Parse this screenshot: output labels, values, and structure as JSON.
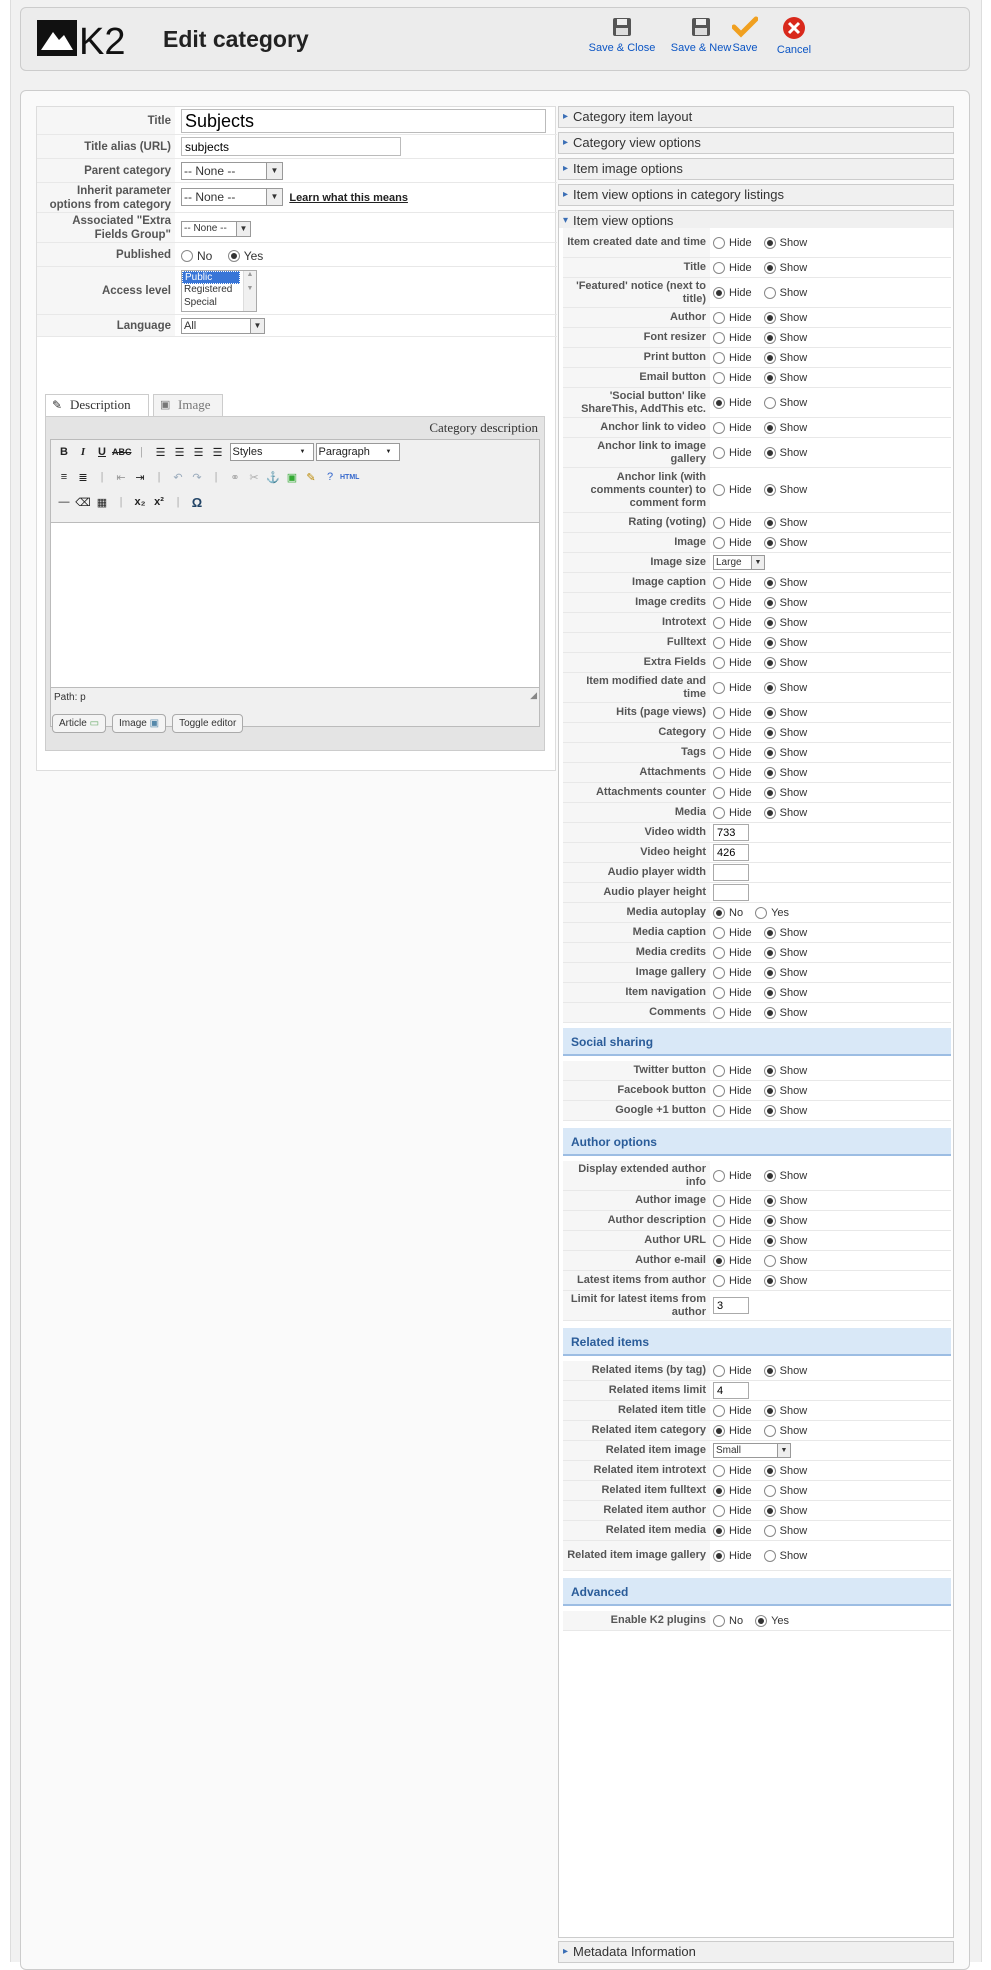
{
  "header": {
    "logo_text": "K2",
    "title": "Edit category",
    "buttons": {
      "save_close": "Save & Close",
      "save_new": "Save & New",
      "save": "Save",
      "cancel": "Cancel"
    }
  },
  "form": {
    "title_label": "Title",
    "title_value": "Subjects",
    "alias_label": "Title alias (URL)",
    "alias_value": "subjects",
    "parent_label": "Parent category",
    "parent_value": "-- None --",
    "inherit_label": "Inherit parameter options from category",
    "inherit_value": "-- None --",
    "inherit_link": "Learn what this means",
    "extra_label": "Associated \"Extra Fields Group\"",
    "extra_value": "-- None --",
    "published_label": "Published",
    "published_no": "No",
    "published_yes": "Yes",
    "access_label": "Access level",
    "access_options": [
      "Public",
      "Registered",
      "Special"
    ],
    "language_label": "Language",
    "language_value": "All"
  },
  "tabs": {
    "description": "Description",
    "image": "Image"
  },
  "editor": {
    "category_description": "Category description",
    "styles": "Styles",
    "paragraph": "Paragraph",
    "path": "Path: p",
    "btn_article": "Article",
    "btn_image": "Image",
    "btn_toggle": "Toggle editor"
  },
  "accordion": {
    "category_item_layout": "Category item layout",
    "category_view_options": "Category view options",
    "item_image_options": "Item image options",
    "item_view_options_listings": "Item view options in category listings",
    "item_view_options": "Item view options",
    "metadata": "Metadata Information"
  },
  "common": {
    "hide": "Hide",
    "show": "Show",
    "no": "No",
    "yes": "Yes"
  },
  "item_view": {
    "created_date": "Item created date and time",
    "title": "Title",
    "featured": "'Featured' notice (next to title)",
    "author": "Author",
    "font_resizer": "Font resizer",
    "print_button": "Print button",
    "email_button": "Email button",
    "social_button": "'Social button' like ShareThis, AddThis etc.",
    "anchor_video": "Anchor link to video",
    "anchor_gallery": "Anchor link to image gallery",
    "anchor_comments": "Anchor link (with comments counter) to comment form",
    "rating": "Rating (voting)",
    "image": "Image",
    "image_size": "Image size",
    "image_size_value": "Large",
    "image_caption": "Image caption",
    "image_credits": "Image credits",
    "introtext": "Introtext",
    "fulltext": "Fulltext",
    "extra_fields": "Extra Fields",
    "modified_date": "Item modified date and time",
    "hits": "Hits (page views)",
    "category": "Category",
    "tags": "Tags",
    "attachments": "Attachments",
    "attachments_counter": "Attachments counter",
    "media": "Media",
    "video_width": "Video width",
    "video_width_value": "733",
    "video_height": "Video height",
    "video_height_value": "426",
    "audio_width": "Audio player width",
    "audio_height": "Audio player height",
    "media_autoplay": "Media autoplay",
    "media_caption": "Media caption",
    "media_credits": "Media credits",
    "image_gallery": "Image gallery",
    "item_navigation": "Item navigation",
    "comments": "Comments"
  },
  "social": {
    "heading": "Social sharing",
    "twitter": "Twitter button",
    "facebook": "Facebook button",
    "google": "Google +1 button"
  },
  "author_opts": {
    "heading": "Author options",
    "extended": "Display extended author info",
    "image": "Author image",
    "description": "Author description",
    "url": "Author URL",
    "email": "Author e-mail",
    "latest": "Latest items from author",
    "limit": "Limit for latest items from author",
    "limit_value": "3"
  },
  "related": {
    "heading": "Related items",
    "by_tag": "Related items (by tag)",
    "limit": "Related items limit",
    "limit_value": "4",
    "title": "Related item title",
    "category": "Related item category",
    "image": "Related item image",
    "image_value": "Small",
    "introtext": "Related item introtext",
    "fulltext": "Related item fulltext",
    "author": "Related item author",
    "media": "Related item media",
    "gallery": "Related item image gallery"
  },
  "advanced": {
    "heading": "Advanced",
    "plugins": "Enable K2 plugins"
  }
}
